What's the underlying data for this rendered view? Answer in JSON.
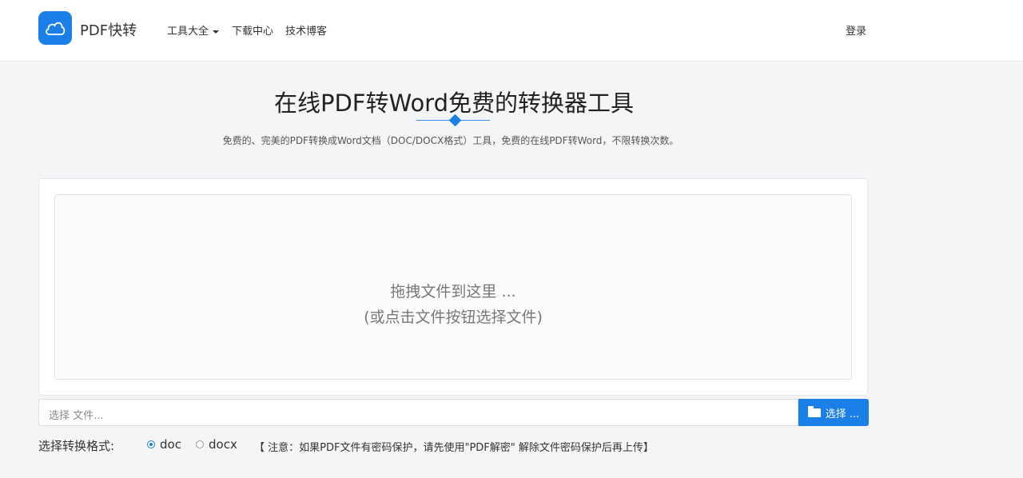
{
  "header": {
    "brand": "PDF快转",
    "nav": [
      {
        "label": "工具大全",
        "has_dropdown": true
      },
      {
        "label": "下载中心"
      },
      {
        "label": "技术博客"
      }
    ],
    "login": "登录"
  },
  "hero": {
    "title": "在线PDF转Word免费的转换器工具",
    "subtitle": "免费的、完美的PDF转换成Word文档（DOC/DOCX格式）工具，免费的在线PDF转Word，不限转换次数。"
  },
  "upload": {
    "drop_text": "拖拽文件到这里 ...",
    "drop_hint": "(或点击文件按钮选择文件)",
    "file_placeholder": "选择 文件...",
    "browse_label": "选择 ..."
  },
  "format": {
    "label": "选择转换格式:",
    "options": [
      {
        "label": "doc",
        "checked": true
      },
      {
        "label": "docx",
        "checked": false
      }
    ],
    "notice": "【 注意：如果PDF文件有密码保护，请先使用\"PDF解密\" 解除文件密码保护后再上传】"
  },
  "colors": {
    "accent": "#1a7fe6",
    "background": "#f4f5f7"
  }
}
